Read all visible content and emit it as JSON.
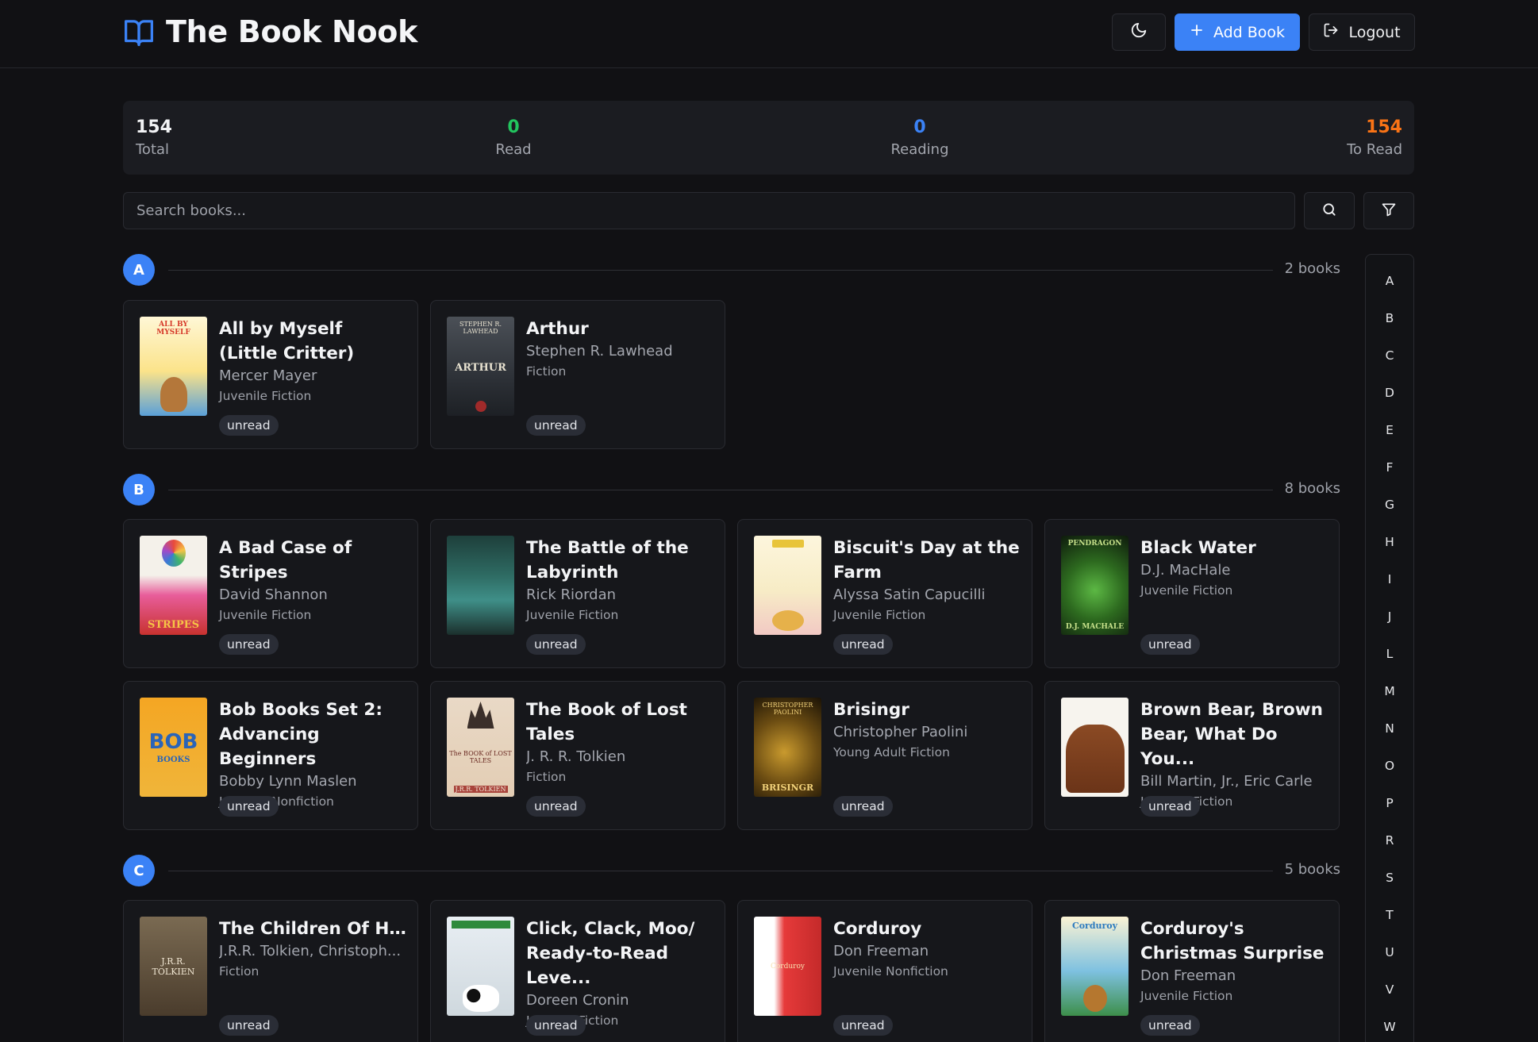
{
  "app": {
    "title": "The Book Nook",
    "add_label": "Add Book",
    "logout_label": "Logout"
  },
  "stats": [
    {
      "value": "154",
      "label": "Total",
      "color": "#f1f2f4"
    },
    {
      "value": "0",
      "label": "Read",
      "color": "#22c55e"
    },
    {
      "value": "0",
      "label": "Reading",
      "color": "#3b82f6"
    },
    {
      "value": "154",
      "label": "To Read",
      "color": "#f97316"
    }
  ],
  "search": {
    "placeholder": "Search books..."
  },
  "colors": {
    "accent": "#3b82f6",
    "background": "#111114",
    "card": "#16171b"
  },
  "sections": [
    {
      "letter": "A",
      "count": "2 books",
      "books": [
        {
          "title": "All by Myself (Little Critter)",
          "author": "Mercer Mayer",
          "genre": "Juvenile Fiction",
          "status": "unread"
        },
        {
          "title": "Arthur",
          "author": "Stephen R. Lawhead",
          "genre": "Fiction",
          "status": "unread"
        }
      ]
    },
    {
      "letter": "B",
      "count": "8 books",
      "books": [
        {
          "title": "A Bad Case of Stripes",
          "author": "David Shannon",
          "genre": "Juvenile Fiction",
          "status": "unread"
        },
        {
          "title": "The Battle of the Labyrinth",
          "author": "Rick Riordan",
          "genre": "Juvenile Fiction",
          "status": "unread"
        },
        {
          "title": "Biscuit's Day at the Farm",
          "author": "Alyssa Satin Capucilli",
          "genre": "Juvenile Fiction",
          "status": "unread"
        },
        {
          "title": "Black Water",
          "author": "D.J. MacHale",
          "genre": "Juvenile Fiction",
          "status": "unread"
        },
        {
          "title": "Bob Books Set 2: Advancing Beginners",
          "author": "Bobby Lynn Maslen",
          "genre": "Juvenile Nonfiction",
          "status": "unread"
        },
        {
          "title": "The Book of Lost Tales",
          "author": "J. R. R. Tolkien",
          "genre": "Fiction",
          "status": "unread"
        },
        {
          "title": "Brisingr",
          "author": "Christopher Paolini",
          "genre": "Young Adult Fiction",
          "status": "unread"
        },
        {
          "title": "Brown Bear, Brown Bear, What Do You...",
          "author": "Bill Martin, Jr., Eric Carle",
          "genre": "Juvenile Fiction",
          "status": "unread"
        }
      ]
    },
    {
      "letter": "C",
      "count": "5 books",
      "books": [
        {
          "title": "The Children Of Húrin",
          "author": "J.R.R. Tolkien, Christoph...",
          "genre": "Fiction",
          "status": "unread"
        },
        {
          "title": "Click, Clack, Moo/ Ready-to-Read Leve...",
          "author": "Doreen Cronin",
          "genre": "Juvenile Fiction",
          "status": "unread"
        },
        {
          "title": "Corduroy",
          "author": "Don Freeman",
          "genre": "Juvenile Nonfiction",
          "status": "unread"
        },
        {
          "title": "Corduroy's Christmas Surprise",
          "author": "Don Freeman",
          "genre": "Juvenile Fiction",
          "status": "unread"
        }
      ]
    }
  ],
  "covers": {
    "all-by-myself": "ALL BY MYSELF",
    "arthur": [
      "STEPHEN R. LAWHEAD",
      "ARTHUR"
    ],
    "stripes": "STRIPES",
    "bob": [
      "BOB",
      "BOOKS"
    ],
    "lost-tales": [
      "The BOOK of LOST TALES",
      "J.R.R. TOLKIEN"
    ],
    "brisingr": [
      "CHRISTOPHER PAOLINI",
      "BRISINGR"
    ],
    "pendragon": [
      "PENDRAGON",
      "D.J. MACHALE"
    ],
    "hurin": "J.R.R. TOLKIEN",
    "corduroy": "Corduroy"
  },
  "alphabet": [
    "A",
    "B",
    "C",
    "D",
    "E",
    "F",
    "G",
    "H",
    "I",
    "J",
    "L",
    "M",
    "N",
    "O",
    "P",
    "R",
    "S",
    "T",
    "U",
    "V",
    "W"
  ]
}
